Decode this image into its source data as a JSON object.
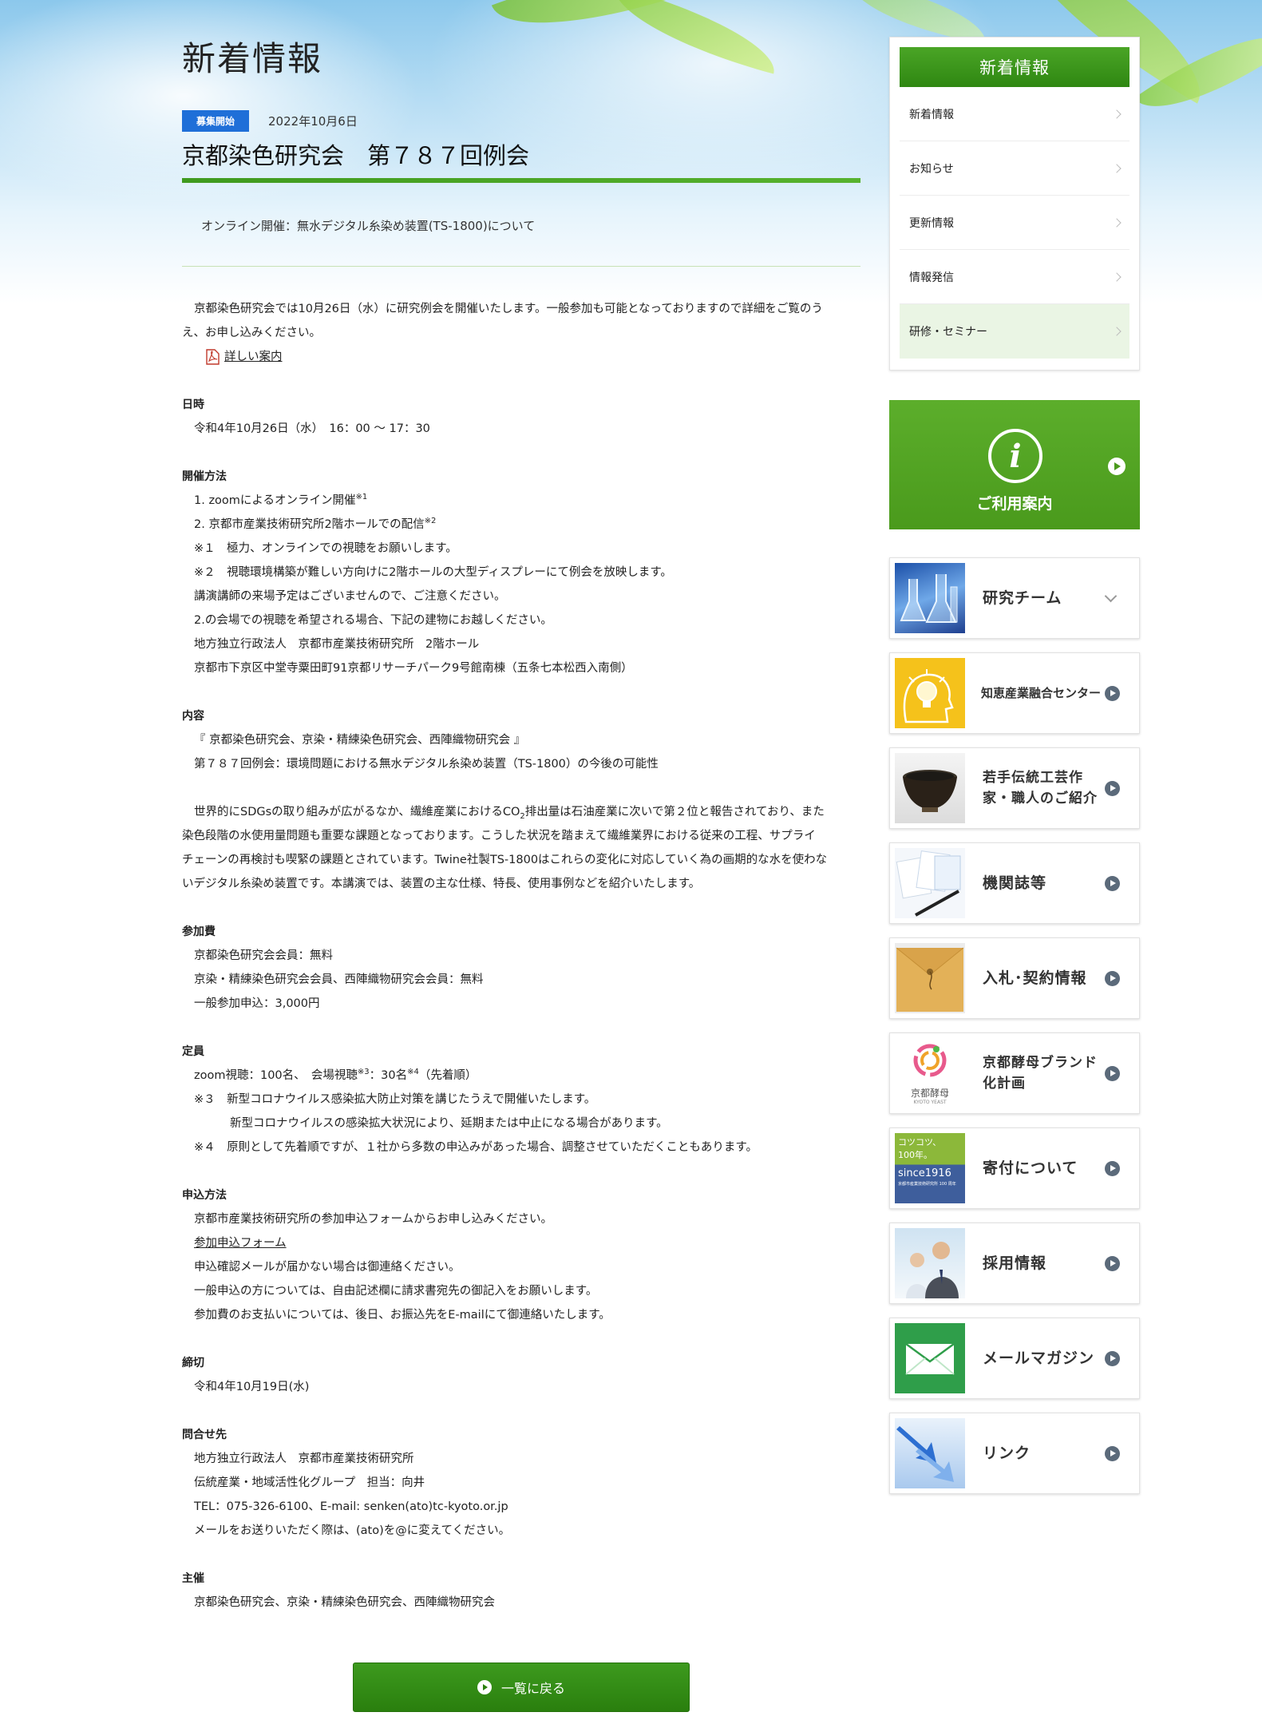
{
  "page": {
    "title": "新着情報"
  },
  "article": {
    "badge": "募集開始",
    "date": "2022年10月6日",
    "title": "京都染色研究会　第７８７回例会",
    "lead": "オンライン開催：無水デジタル糸染め装置(TS-1800)について",
    "intro_1": "京都染色研究会では10月26日（水）に研究例会を開催いたします。一般参加も可能となっておりますので詳細をご覧のう",
    "intro_2": "え、お申し込みください。",
    "pdf_link": "詳しい案内",
    "schedule_head": "日時",
    "schedule": "令和4年10月26日（水）　16：00 ～ 17：30",
    "method_head": "開催方法",
    "method_1": "1. zoomによるオンライン開催",
    "method_1_note": "※1",
    "method_2": "2. 京都市産業技術研究所2階ホールでの配信",
    "method_2_note": "※2",
    "method_note_1": "※１　極力、オンラインでの視聴をお願いします。",
    "method_note_2": "※２　視聴環境構築が難しい方向けに2階ホールの大型ディスプレーにて例会を放映します。",
    "method_note_3": "講演講師の来場予定はございませんので、ご注意ください。",
    "method_note_4": "2.の会場での視聴を希望される場合、下記の建物にお越しください。",
    "method_place_1": "地方独立行政法人　京都市産業技術研究所　2階ホール",
    "method_place_2": "京都市下京区中堂寺粟田町91京都リサーチパーク9号館南棟（五条七本松西入南側）",
    "content_head": "内容",
    "content_1": "『 京都染色研究会、京染・精練染色研究会、西陣織物研究会 』",
    "content_2": "第７８７回例会：環境問題における無水デジタル糸染め装置（TS-1800）の今後の可能性",
    "desc_1a": "世界的にSDGsの取り組みが広がるなか、繊維産業におけるCO",
    "desc_1_sub": "2",
    "desc_1b": "排出量は石油産業に次いで第２位と報告されており、また",
    "desc_2": "染色段階の水使用量問題も重要な課題となっております。こうした状況を踏まえて繊維業界における従来の工程、サプライ",
    "desc_3": "チェーンの再検討も喫緊の課題とされています。Twine社製TS-1800はこれらの変化に対応していく為の画期的な水を使わな",
    "desc_4": "いデジタル糸染め装置です。本講演では、装置の主な仕様、特長、使用事例などを紹介いたします。",
    "fee_head": "参加費",
    "fee_1": "京都染色研究会会員：無料",
    "fee_2": "京染・精練染色研究会会員、西陣織物研究会会員：無料",
    "fee_3": "一般参加申込：3,000円",
    "cap_head": "定員",
    "cap_1a": "zoom視聴：100名、　会場視聴",
    "cap_1_note3": "※3",
    "cap_1b": "：30名",
    "cap_1_note4": "※4",
    "cap_1c": "（先着順）",
    "cap_2": "※３　新型コロナウイルス感染拡大防止対策を講じたうえで開催いたします。",
    "cap_3": "新型コロナウイルスの感染拡大状況により、延期または中止になる場合があります。",
    "cap_4": "※４　原則として先着順ですが、１社から多数の申込みがあった場合、調整させていただくこともあります。",
    "apply_head": "申込方法",
    "apply_1": "京都市産業技術研究所の参加申込フォームからお申し込みください。",
    "apply_link": "参加申込フォーム",
    "apply_2": "申込確認メールが届かない場合は御連絡ください。",
    "apply_3": "一般申込の方については、自由記述欄に請求書宛先の御記入をお願いします。",
    "apply_4": "参加費のお支払いについては、後日、お振込先をE-mailにて御連絡いたします。",
    "deadline_head": "締切",
    "deadline": "令和4年10月19日(水)",
    "contact_head": "問合せ先",
    "contact_1": "地方独立行政法人　京都市産業技術研究所",
    "contact_2": "伝統産業・地域活性化グループ　担当：向井",
    "contact_3": "TEL：075-326-6100、E-mail: senken(ato)tc-kyoto.or.jp",
    "contact_4": "メールをお送りいただく際は、(ato)を@に変えてください。",
    "host_head": "主催",
    "host": "京都染色研究会、京染・精練染色研究会、西陣織物研究会",
    "back_button": "一覧に戻る"
  },
  "sidebar": {
    "heading": "新着情報",
    "items": [
      {
        "label": "新着情報"
      },
      {
        "label": "お知らせ"
      },
      {
        "label": "更新情報"
      },
      {
        "label": "情報発信"
      },
      {
        "label": "研修・セミナー"
      }
    ],
    "guide": "ご利用案内",
    "banners": [
      {
        "label": "研究チーム",
        "thumb": "lab-glassware"
      },
      {
        "label": "知恵産業融合センター",
        "thumb": "lightbulb-head"
      },
      {
        "label": "若手伝統工芸作家・職人のご紹介",
        "thumb": "tea-bowl"
      },
      {
        "label": "機関誌等",
        "thumb": "documents-pen"
      },
      {
        "label": "入札･契約情報",
        "thumb": "envelope-brown"
      },
      {
        "label": "京都酵母ブランド化計画",
        "thumb": "kyoto-yeast-logo"
      },
      {
        "label": "寄付について",
        "thumb": "since-1916"
      },
      {
        "label": "採用情報",
        "thumb": "staff-photo"
      },
      {
        "label": "メールマガジン",
        "thumb": "mail-envelope"
      },
      {
        "label": "リンク",
        "thumb": "arrows"
      }
    ],
    "yeast_logo_text": "京都酵母",
    "yeast_logo_sub": "KYOTO YEAST",
    "since_text_1": "コツコツ、",
    "since_text_2": "100年。",
    "since_text_3": "since1916",
    "since_text_4": "京都市産業技術研究所 100 周年"
  },
  "colors": {
    "accent_green": "#3f9a1f",
    "badge_blue": "#1f6fd8",
    "active_bg": "#eaf5e4"
  }
}
